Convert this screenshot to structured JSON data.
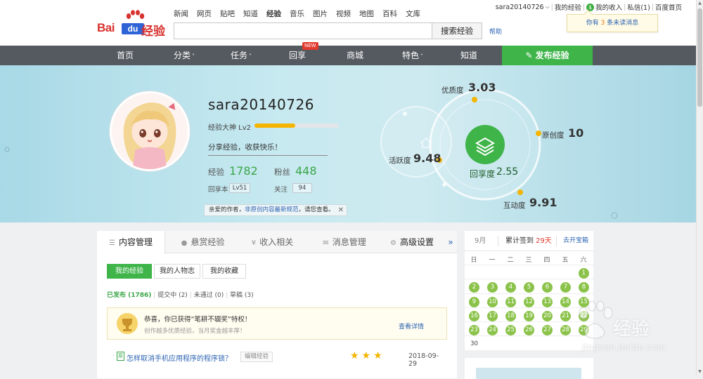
{
  "header": {
    "logo_text": "Baidu经验",
    "nav_links": [
      {
        "label": "新闻"
      },
      {
        "label": "网页"
      },
      {
        "label": "贴吧"
      },
      {
        "label": "知道"
      },
      {
        "label": "经验",
        "active": true
      },
      {
        "label": "音乐"
      },
      {
        "label": "图片"
      },
      {
        "label": "视频"
      },
      {
        "label": "地图"
      },
      {
        "label": "百科"
      },
      {
        "label": "文库"
      }
    ],
    "search_value": "",
    "search_button": "搜索经验",
    "help": "帮助"
  },
  "userbar": {
    "username": "sara20140726",
    "my_exp": "我的经验",
    "income": "我的收入",
    "messages": "私信(1)",
    "home": "百度首页",
    "notice_prefix": "你有",
    "notice_count": "3",
    "notice_suffix": "条未读消息"
  },
  "main_nav": {
    "items": [
      "首页",
      "分类",
      "任务",
      "回享",
      "商城",
      "特色",
      "知道"
    ],
    "new_badge": "NEW",
    "publish": "发布经验"
  },
  "profile": {
    "username": "sara20140726",
    "level": "经验大神 Lv2",
    "level_progress": 0.48,
    "motto": "分享经验，收获快乐！",
    "exp_label": "经验",
    "exp_value": "1782",
    "fans_label": "粉丝",
    "fans_value": "448",
    "huixiang_label": "回享本",
    "huixiang_value": "Lv51",
    "follow_label": "关注",
    "follow_value": "94",
    "notice_prefix": "亲爱的作者，",
    "notice_link": "非原创内容最新规范",
    "notice_suffix": "，请您查看。"
  },
  "scores": {
    "quality_label": "优质度",
    "quality": "3.03",
    "original_label": "原创度",
    "original": "10",
    "activity_label": "活跃度",
    "activity": "9.48",
    "interaction_label": "互动度",
    "interaction": "9.91",
    "huixiang_label": "回享度",
    "huixiang": "2.55"
  },
  "tabs": {
    "items": [
      "内容管理",
      "悬赏经验",
      "收入相关",
      "消息管理",
      "高级设置"
    ],
    "more": "»",
    "sub": [
      "我的经验",
      "我的人物志",
      "我的收藏"
    ],
    "filters": {
      "published": "已发布 (1786)",
      "submitting": "提交中 (2)",
      "rejected": "未通过 (0)",
      "draft": "草稿 (3)"
    },
    "congrats_title": "恭喜，你已获得“笔耕不辍奖”特权！",
    "congrats_sub": "创作越多优质经验，当月奖金越丰厚！",
    "congrats_more": "查看详情",
    "article_title": "怎样取消手机应用程序的程序锁？",
    "article_edit": "编辑经验",
    "article_date": "2018-09-29",
    "article_rating": 3
  },
  "calendar": {
    "month": "9月",
    "checkin_label": "累计签到",
    "checkin_days": "29天",
    "treasure": "去开宝箱",
    "weekdays": [
      "日",
      "一",
      "二",
      "三",
      "四",
      "五",
      "六"
    ],
    "checked_days": [
      "1",
      "2",
      "3",
      "4",
      "5",
      "6",
      "7",
      "8",
      "9",
      "10",
      "11",
      "12",
      "13",
      "14",
      "15",
      "16",
      "17",
      "18",
      "19",
      "20",
      "21",
      "22",
      "23",
      "24",
      "25",
      "26",
      "27",
      "28",
      "29"
    ],
    "last_day": "30"
  },
  "watermark": {
    "text": "经验",
    "url": "jingyan.baidu.com"
  },
  "colors": {
    "brand_red": "#d8322e",
    "green": "#3eb449",
    "nav_bg": "#555a60",
    "link": "#2d64b3",
    "gold": "#f4b400"
  }
}
